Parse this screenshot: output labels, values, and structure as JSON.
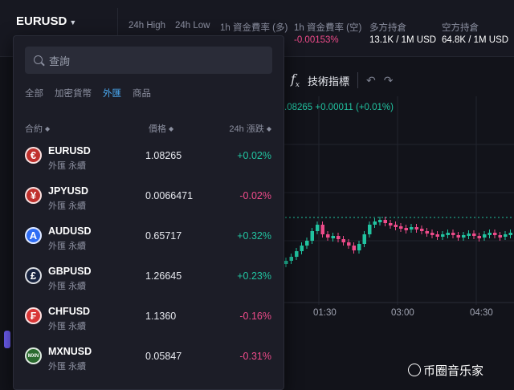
{
  "header": {
    "pair": "EURUSD",
    "stats": [
      {
        "label": "24h High",
        "value": ""
      },
      {
        "label": "24h Low",
        "value": ""
      },
      {
        "label": "1h 資金費率 (多)",
        "value": ""
      },
      {
        "label": "1h 資金費率 (空)",
        "value": "-0.00153%"
      },
      {
        "label": "多方持倉",
        "value": "13.1K / 1M USD"
      },
      {
        "label": "空方持倉",
        "value": "64.8K / 1M USD"
      }
    ]
  },
  "toolbar": {
    "fx_symbol": "f",
    "fx_sub": "x",
    "indicators_label": "技術指標"
  },
  "chart": {
    "ticker_text": ".08265 +0.00011 (+0.01%)",
    "x_labels": [
      "01:30",
      "03:00",
      "04:30"
    ]
  },
  "dropdown": {
    "search_placeholder": "查詢",
    "categories": [
      "全部",
      "加密貨幣",
      "外匯",
      "商品"
    ],
    "active_category": "外匯",
    "columns": {
      "contract": "合約",
      "price": "價格",
      "change": "24h 漲跌"
    },
    "rows": [
      {
        "symbol": "EURUSD",
        "sub": "外匯 永續",
        "price": "1.08265",
        "change": "+0.02%",
        "icon": "euro-icon",
        "glyph": "€",
        "color": "#c0312d"
      },
      {
        "symbol": "JPYUSD",
        "sub": "外匯 永續",
        "price": "0.0066471",
        "change": "-0.02%",
        "icon": "yen-icon",
        "glyph": "¥",
        "color": "#c0312d"
      },
      {
        "symbol": "AUDUSD",
        "sub": "外匯 永續",
        "price": "0.65717",
        "change": "+0.32%",
        "icon": "aud-icon",
        "glyph": "A",
        "color": "#2f6ef5"
      },
      {
        "symbol": "GBPUSD",
        "sub": "外匯 永續",
        "price": "1.26645",
        "change": "+0.23%",
        "icon": "pound-icon",
        "glyph": "£",
        "color": "#17233f"
      },
      {
        "symbol": "CHFUSD",
        "sub": "外匯 永續",
        "price": "1.1360",
        "change": "-0.16%",
        "icon": "franc-icon",
        "glyph": "₣",
        "color": "#d93737"
      },
      {
        "symbol": "MXNUSD",
        "sub": "外匯 永續",
        "price": "0.05847",
        "change": "-0.31%",
        "icon": "mxn-icon",
        "glyph": "MXN",
        "color": "#2a6a2e"
      }
    ]
  },
  "colors": {
    "positive": "#21c3a0",
    "negative": "#ee4b8a",
    "accent": "#4aa8f0"
  },
  "watermark": "币圈音乐家"
}
